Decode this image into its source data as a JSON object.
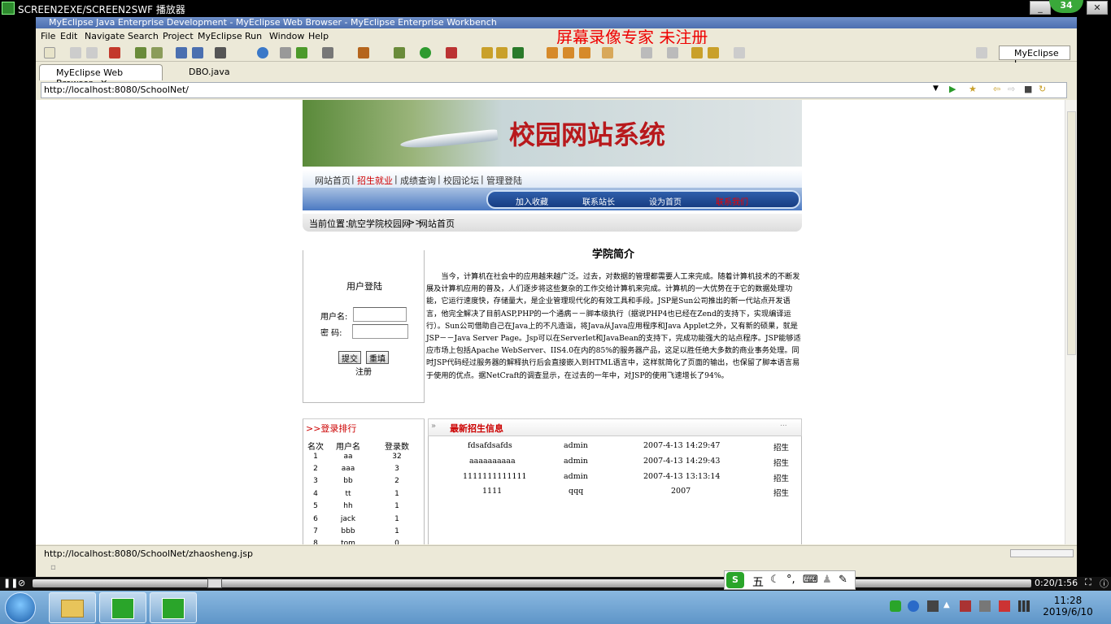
{
  "player": {
    "title": "SCREEN2EXE/SCREEN2SWF 播放器",
    "badge": "34",
    "time": "0:20/1:56"
  },
  "ide": {
    "title": "MyEclipse Java Enterprise Development - MyEclipse Web Browser - MyEclipse Enterprise Workbench",
    "watermark": "屏幕录像专家  未注册",
    "menu": [
      "File",
      "Edit",
      "Navigate",
      "Search",
      "Project",
      "MyEclipse",
      "Run",
      "Window",
      "Help"
    ],
    "perspective": "MyEclipse J...",
    "tabs": [
      {
        "label": "MyEclipse Web Browser"
      },
      {
        "label": "DBO.java"
      }
    ],
    "address": "http://localhost:8080/SchoolNet/",
    "status": "http://localhost:8080/SchoolNet/zhaosheng.jsp"
  },
  "site": {
    "title": "校园网站系统",
    "nav": [
      "网站首页",
      "招生就业",
      "成绩查询",
      "校园论坛",
      "管理登陆"
    ],
    "subnav": [
      "加入收藏",
      "联系站长",
      "设为首页",
      "联系我们"
    ],
    "breadcrumb": {
      "label": "当前位置：",
      "site": "航空学院校园网",
      "sep": ">>",
      "page": "网站首页"
    },
    "login": {
      "title": "用户登陆",
      "username_label": "用户名:",
      "password_label": "密  码:",
      "submit": "提交",
      "reset": "重填",
      "register": "注册"
    },
    "intro": {
      "title": "学院简介",
      "text": "当今，计算机在社会中的应用越来越广泛。过去，对数据的管理都需要人工来完成。随着计算机技术的不断发展及计算机应用的普及，人们逐步将这些复杂的工作交给计算机来完成。计算机的一大优势在于它的数据处理功能，它运行速度快，存储量大，是企业管理现代化的有效工具和手段。JSP是Sun公司推出的新一代站点开发语言，他完全解决了目前ASP,PHP的一个通病－－脚本级执行（据说PHP4也已经在Zend的支持下，实现编译运行）。Sun公司借助自己在Java上的不凡造诣，将Java从Java应用程序和Java Applet之外，又有新的硕果，就是JSP－－Java Server Page。Jsp可以在Serverlet和JavaBean的支持下，完成功能强大的站点程序。JSP能够适应市场上包括Apache WebServer、IIS4.0在内的85%的服务器产品，这足以胜任绝大多数的商业事务处理。同时JSP代码经过服务器的解释执行后会直接嵌入到HTML语言中，这样就简化了页面的输出，也保留了脚本语言易于使用的优点。据NetCraft的调查显示，在过去的一年中，对JSP的使用飞速增长了94%。"
    },
    "ranking": {
      "title": ">>登录排行",
      "headers": [
        "名次",
        "用户名",
        "登录数"
      ],
      "rows": [
        [
          "1",
          "aa",
          "32"
        ],
        [
          "2",
          "aaa",
          "3"
        ],
        [
          "3",
          "bb",
          "2"
        ],
        [
          "4",
          "tt",
          "1"
        ],
        [
          "5",
          "hh",
          "1"
        ],
        [
          "6",
          "jack",
          "1"
        ],
        [
          "7",
          "bbb",
          "1"
        ],
        [
          "8",
          "tom",
          "0"
        ]
      ]
    },
    "recruit": {
      "title": "最新招生信息",
      "rows": [
        [
          "fdsafdsafds",
          "admin",
          "2007-4-13 14:29:47",
          "招生"
        ],
        [
          "aaaaaaaaaa",
          "admin",
          "2007-4-13 14:29:43",
          "招生"
        ],
        [
          "1111111111111",
          "admin",
          "2007-4-13 13:13:14",
          "招生"
        ],
        [
          "1111",
          "qqq",
          "2007",
          "招生"
        ]
      ]
    }
  },
  "ime": {
    "label": "五"
  },
  "taskbar": {
    "time": "11:28",
    "date": "2019/6/10"
  },
  "colors": {
    "site_title": "#b8191c",
    "nav_highlight": "#d00000",
    "watermark": "#ee0000"
  }
}
